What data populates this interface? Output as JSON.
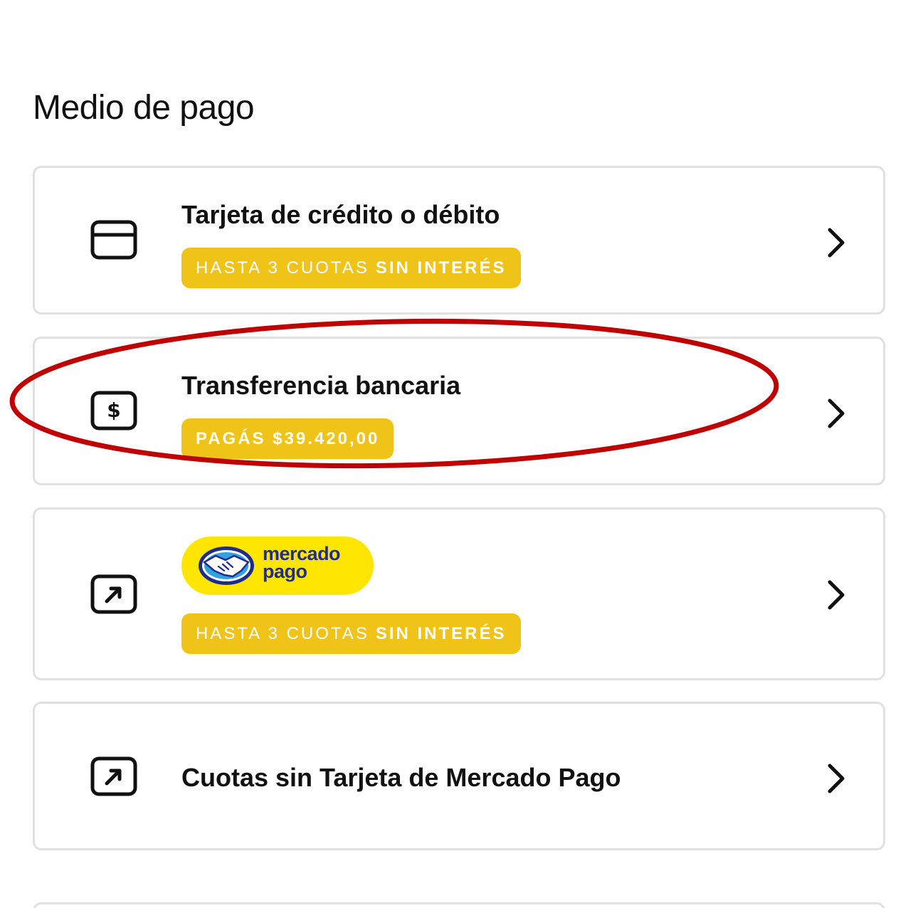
{
  "section": {
    "title": "Medio de pago"
  },
  "options": [
    {
      "title": "Tarjeta de crédito o débito",
      "icon": "credit-card-icon",
      "badge": {
        "normal": "HASTA 3 CUOTAS",
        "bold": "SIN INTERÉS"
      }
    },
    {
      "title": "Transferencia bancaria",
      "icon": "dollar-icon",
      "badge": {
        "bold": "PAGÁS $39.420,00"
      }
    },
    {
      "logo": {
        "line1": "mercado",
        "line2": "pago"
      },
      "icon": "external-link-icon",
      "badge": {
        "normal": "HASTA 3 CUOTAS",
        "bold": "SIN INTERÉS"
      }
    },
    {
      "title": "Cuotas sin Tarjeta de Mercado Pago",
      "icon": "external-link-icon"
    }
  ],
  "colors": {
    "badge": "#efc318",
    "logo_bg": "#ffe600",
    "logo_text": "#1f2c8e",
    "highlight": "#c00000",
    "border": "#e0e0e0"
  }
}
